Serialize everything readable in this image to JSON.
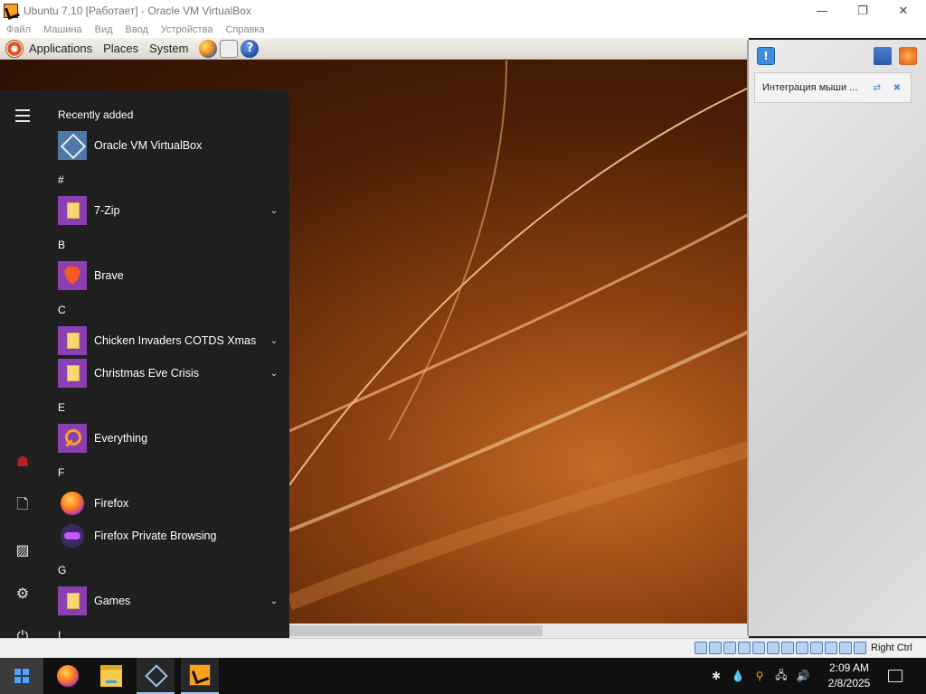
{
  "window": {
    "title": "Ubuntu 7.10 [Работает] - Oracle VM VirtualBox",
    "minimize": "—",
    "restore": "❐",
    "close": "✕"
  },
  "vbox_menu": [
    "Файл",
    "Машина",
    "Вид",
    "Ввод",
    "Устройства",
    "Справка"
  ],
  "gnome_panel": {
    "applications": "Applications",
    "places": "Places",
    "system": "System",
    "help_glyph": "?"
  },
  "start_menu": {
    "recently_added_label": "Recently added",
    "sections": [
      {
        "letter": "",
        "items": [
          {
            "name": "Oracle VM VirtualBox",
            "icon": "virtualbox-icon",
            "expandable": false
          }
        ]
      },
      {
        "letter": "#",
        "items": [
          {
            "name": "7-Zip",
            "icon": "folder-icon",
            "expandable": true
          }
        ]
      },
      {
        "letter": "B",
        "items": [
          {
            "name": "Brave",
            "icon": "brave-icon",
            "expandable": false
          }
        ]
      },
      {
        "letter": "C",
        "items": [
          {
            "name": "Chicken Invaders COTDS Xmas",
            "icon": "folder-icon",
            "expandable": true
          },
          {
            "name": "Christmas Eve Crisis",
            "icon": "folder-icon",
            "expandable": true
          }
        ]
      },
      {
        "letter": "E",
        "items": [
          {
            "name": "Everything",
            "icon": "search-icon",
            "expandable": false
          }
        ]
      },
      {
        "letter": "F",
        "items": [
          {
            "name": "Firefox",
            "icon": "firefox-icon",
            "expandable": false
          },
          {
            "name": "Firefox Private Browsing",
            "icon": "firefox-private-icon",
            "expandable": false
          }
        ]
      },
      {
        "letter": "G",
        "items": [
          {
            "name": "Games",
            "icon": "folder-icon",
            "expandable": true
          }
        ]
      },
      {
        "letter": "I",
        "items": []
      }
    ],
    "chevron_glyph": "⌄",
    "rail": {
      "user_glyph": "☗",
      "documents_glyph": "🗋",
      "pictures_glyph": "▨",
      "settings_glyph": "⚙",
      "power_glyph": "⏻"
    }
  },
  "mini_panel": {
    "notify_glyph": "!",
    "notice_text": "Интеграция мыши ...",
    "notice_toggle_glyph": "⇄",
    "notice_close_glyph": "✖"
  },
  "statusbar": {
    "host_key": "Right Ctrl"
  },
  "taskbar": {
    "clock_time": "2:09 AM",
    "clock_date": "2/8/2025",
    "tray": {
      "defender_glyph": "✱",
      "drop_glyph": "💧",
      "search_glyph": "⚲",
      "network_glyph": "🖧",
      "volume_glyph": "🔊"
    }
  },
  "colors": {
    "accent_windows": "#4aa3ff",
    "start_menu_bg": "#1f1f1f",
    "tile_purple": "#8b3fb3"
  }
}
